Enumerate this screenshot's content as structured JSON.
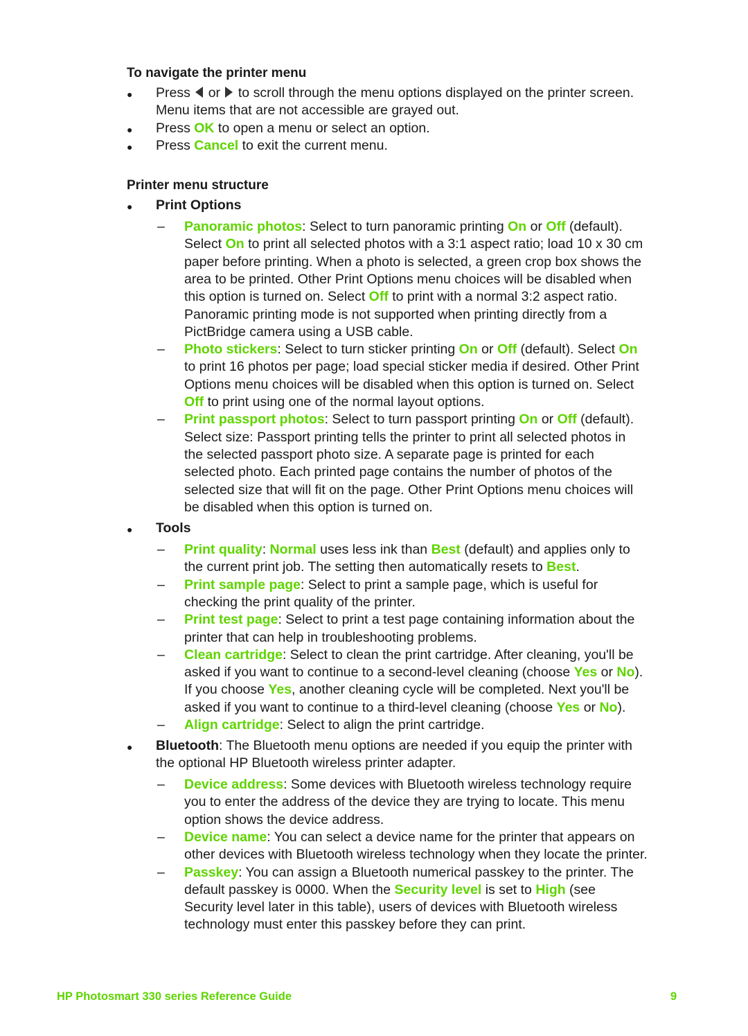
{
  "colors": {
    "accent": "#5fd400",
    "text": "#1a1a1a"
  },
  "nav_section": {
    "heading": "To navigate the printer menu",
    "bullets": [
      {
        "pre": "Press",
        "icon1": "left-arrow-icon",
        "mid": "or",
        "icon2": "right-arrow-icon",
        "post": "to scroll through the menu options displayed on the printer screen.",
        "line2": "Menu items that are not accessible are grayed out."
      },
      {
        "pre": "Press ",
        "key": "OK",
        "post": " to open a menu or select an option."
      },
      {
        "pre": "Press ",
        "key": "Cancel",
        "post": " to exit the current menu."
      }
    ]
  },
  "structure": {
    "heading": "Printer menu structure",
    "print_options": {
      "label": "Print Options",
      "items": [
        {
          "lines": [
            [
              {
                "t": "Panoramic photos",
                "g": true
              },
              {
                "t": ": Select to turn panoramic printing "
              },
              {
                "t": "On",
                "g": true
              },
              {
                "t": " or "
              },
              {
                "t": "Off",
                "g": true
              },
              {
                "t": " (default)."
              }
            ],
            [
              {
                "t": "Select "
              },
              {
                "t": "On",
                "g": true
              },
              {
                "t": " to print all selected photos with a 3:1 aspect ratio; load 10 x 30 cm"
              }
            ],
            [
              {
                "t": "paper before printing. When a photo is selected, a green crop box shows the"
              }
            ],
            [
              {
                "t": "area to be printed. Other Print Options menu choices will be disabled when"
              }
            ],
            [
              {
                "t": "this option is turned on. Select "
              },
              {
                "t": "Off",
                "g": true
              },
              {
                "t": " to print with a normal 3:2 aspect ratio."
              }
            ],
            [
              {
                "t": "Panoramic printing mode is not supported when printing directly from a"
              }
            ],
            [
              {
                "t": "PictBridge camera using a USB cable."
              }
            ]
          ]
        },
        {
          "lines": [
            [
              {
                "t": "Photo stickers",
                "g": true
              },
              {
                "t": ": Select to turn sticker printing "
              },
              {
                "t": "On",
                "g": true
              },
              {
                "t": " or "
              },
              {
                "t": "Off",
                "g": true
              },
              {
                "t": " (default). Select "
              },
              {
                "t": "On",
                "g": true
              }
            ],
            [
              {
                "t": "to print 16 photos per page; load special sticker media if desired. Other Print"
              }
            ],
            [
              {
                "t": "Options menu choices will be disabled when this option is turned on. Select"
              }
            ],
            [
              {
                "t": "Off",
                "g": true
              },
              {
                "t": " to print using one of the normal layout options."
              }
            ]
          ]
        },
        {
          "lines": [
            [
              {
                "t": "Print passport photos",
                "g": true
              },
              {
                "t": ": Select to turn passport printing "
              },
              {
                "t": "On",
                "g": true
              },
              {
                "t": " or "
              },
              {
                "t": "Off",
                "g": true
              },
              {
                "t": " (default)."
              }
            ],
            [
              {
                "t": "Select size: Passport printing tells the printer to print all selected photos in"
              }
            ],
            [
              {
                "t": "the selected passport photo size. A separate page is printed for each"
              }
            ],
            [
              {
                "t": "selected photo. Each printed page contains the number of photos of the"
              }
            ],
            [
              {
                "t": "selected size that will fit on the page. Other Print Options menu choices will"
              }
            ],
            [
              {
                "t": "be disabled when this option is turned on."
              }
            ]
          ]
        }
      ]
    },
    "tools": {
      "label": "Tools",
      "items": [
        {
          "lines": [
            [
              {
                "t": "Print quality",
                "g": true
              },
              {
                "t": ": "
              },
              {
                "t": "Normal",
                "g": true
              },
              {
                "t": " uses less ink than "
              },
              {
                "t": "Best",
                "g": true
              },
              {
                "t": " (default) and applies only to"
              }
            ],
            [
              {
                "t": "the current print job. The setting then automatically resets to "
              },
              {
                "t": "Best",
                "g": true
              },
              {
                "t": "."
              }
            ]
          ]
        },
        {
          "lines": [
            [
              {
                "t": "Print sample page",
                "g": true
              },
              {
                "t": ": Select to print a sample page, which is useful for"
              }
            ],
            [
              {
                "t": "checking the print quality of the printer."
              }
            ]
          ]
        },
        {
          "lines": [
            [
              {
                "t": "Print test page",
                "g": true
              },
              {
                "t": ": Select to print a test page containing information about the"
              }
            ],
            [
              {
                "t": "printer that can help in troubleshooting problems."
              }
            ]
          ]
        },
        {
          "lines": [
            [
              {
                "t": "Clean cartridge",
                "g": true
              },
              {
                "t": ": Select to clean the print cartridge. After cleaning, you'll be"
              }
            ],
            [
              {
                "t": "asked if you want to continue to a second-level cleaning (choose "
              },
              {
                "t": "Yes",
                "g": true
              },
              {
                "t": " or "
              },
              {
                "t": "No",
                "g": true
              },
              {
                "t": ")."
              }
            ],
            [
              {
                "t": "If you choose "
              },
              {
                "t": "Yes",
                "g": true
              },
              {
                "t": ", another cleaning cycle will be completed. Next you'll be"
              }
            ],
            [
              {
                "t": "asked if you want to continue to a third-level cleaning (choose "
              },
              {
                "t": "Yes",
                "g": true
              },
              {
                "t": " or "
              },
              {
                "t": "No",
                "g": true
              },
              {
                "t": ")."
              }
            ]
          ]
        },
        {
          "lines": [
            [
              {
                "t": "Align cartridge",
                "g": true
              },
              {
                "t": ": Select to align the print cartridge."
              }
            ]
          ]
        }
      ]
    },
    "bluetooth": {
      "label": "Bluetooth",
      "desc_line1": ": The Bluetooth menu options are needed if you equip the printer with",
      "desc_line2": "the optional HP Bluetooth wireless printer adapter.",
      "items": [
        {
          "lines": [
            [
              {
                "t": "Device address",
                "g": true
              },
              {
                "t": ": Some devices with Bluetooth wireless technology require"
              }
            ],
            [
              {
                "t": "you to enter the address of the device they are trying to locate. This menu"
              }
            ],
            [
              {
                "t": "option shows the device address."
              }
            ]
          ]
        },
        {
          "lines": [
            [
              {
                "t": "Device name",
                "g": true
              },
              {
                "t": ": You can select a device name for the printer that appears on"
              }
            ],
            [
              {
                "t": "other devices with Bluetooth wireless technology when they locate the printer."
              }
            ]
          ]
        },
        {
          "lines": [
            [
              {
                "t": "Passkey",
                "g": true
              },
              {
                "t": ": You can assign a Bluetooth numerical passkey to the printer. The"
              }
            ],
            [
              {
                "t": "default passkey is 0000. When the "
              },
              {
                "t": "Security level",
                "g": true
              },
              {
                "t": " is set to "
              },
              {
                "t": "High",
                "g": true
              },
              {
                "t": " (see"
              }
            ],
            [
              {
                "t": "Security level later in this table), users of devices with Bluetooth wireless"
              }
            ],
            [
              {
                "t": "technology must enter this passkey before they can print."
              }
            ]
          ]
        }
      ]
    }
  },
  "footer": {
    "title": "HP Photosmart 330 series Reference Guide",
    "page_number": "9"
  }
}
